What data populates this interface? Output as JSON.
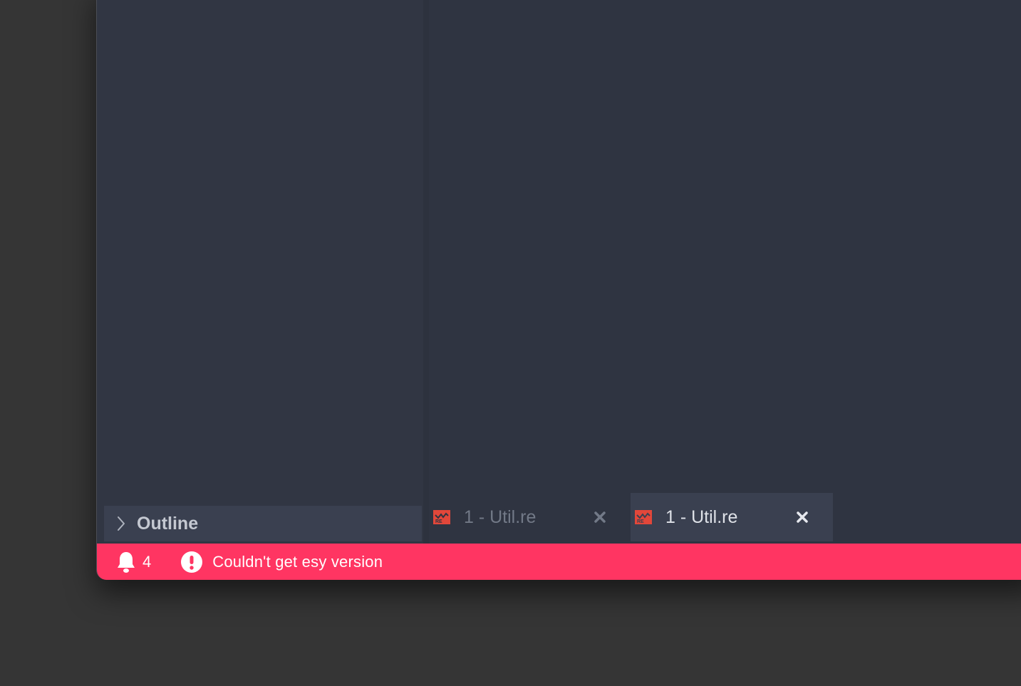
{
  "sidebar": {
    "outline": {
      "label": "Outline",
      "icon": "chevron-right-icon"
    }
  },
  "tabs": [
    {
      "label": "1 - Util.re",
      "icon": "reason-file-icon",
      "active": false
    },
    {
      "label": "1 - Util.re",
      "icon": "reason-file-icon",
      "active": true
    }
  ],
  "statusbar": {
    "notification_count": "4",
    "message": "Couldn't get esy version",
    "bell_icon": "bell-icon",
    "alert_icon": "alert-circle-icon",
    "background_color": "#ff3562"
  },
  "colors": {
    "editor_background": "#2f3441",
    "tab_active_background": "#3a4050",
    "file_icon_color": "#e2473a",
    "desktop_background": "#353535"
  }
}
